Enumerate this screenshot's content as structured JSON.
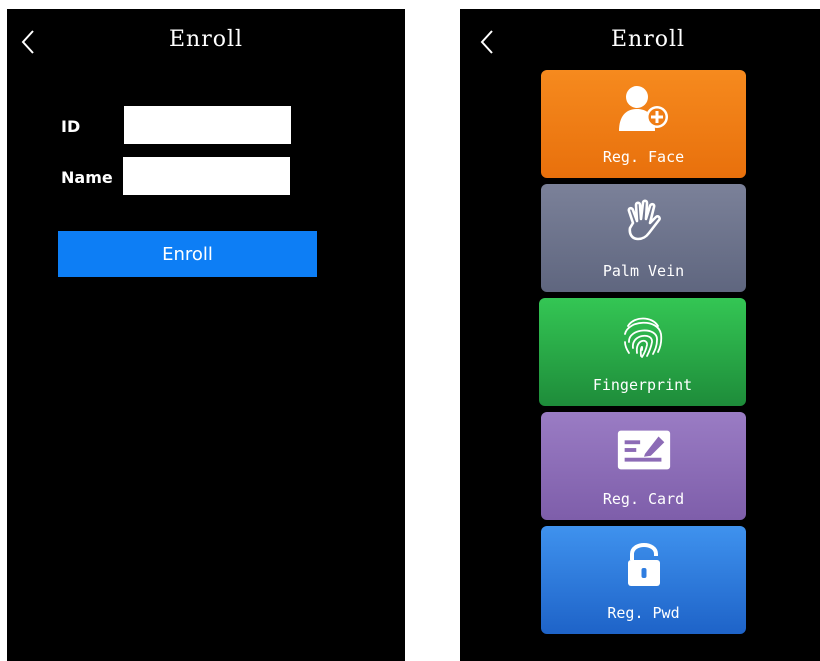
{
  "left_screen": {
    "title": "Enroll",
    "back_icon": "chevron-left-icon",
    "id_label": "ID",
    "id_value": "",
    "name_label": "Name",
    "name_value": "",
    "enroll_button": "Enroll",
    "accent_color": "#0d7ef5"
  },
  "right_screen": {
    "title": "Enroll",
    "back_icon": "chevron-left-icon",
    "tiles": [
      {
        "label": "Reg. Face",
        "icon": "add-user-icon",
        "color": "#f07d14"
      },
      {
        "label": "Palm Vein",
        "icon": "palm-icon",
        "color": "#6d7490"
      },
      {
        "label": "Fingerprint",
        "icon": "fingerprint-icon",
        "color": "#2aa84a"
      },
      {
        "label": "Reg. Card",
        "icon": "card-icon",
        "color": "#8c6bb6"
      },
      {
        "label": "Reg. Pwd",
        "icon": "lock-icon",
        "color": "#2f7de0"
      }
    ]
  }
}
